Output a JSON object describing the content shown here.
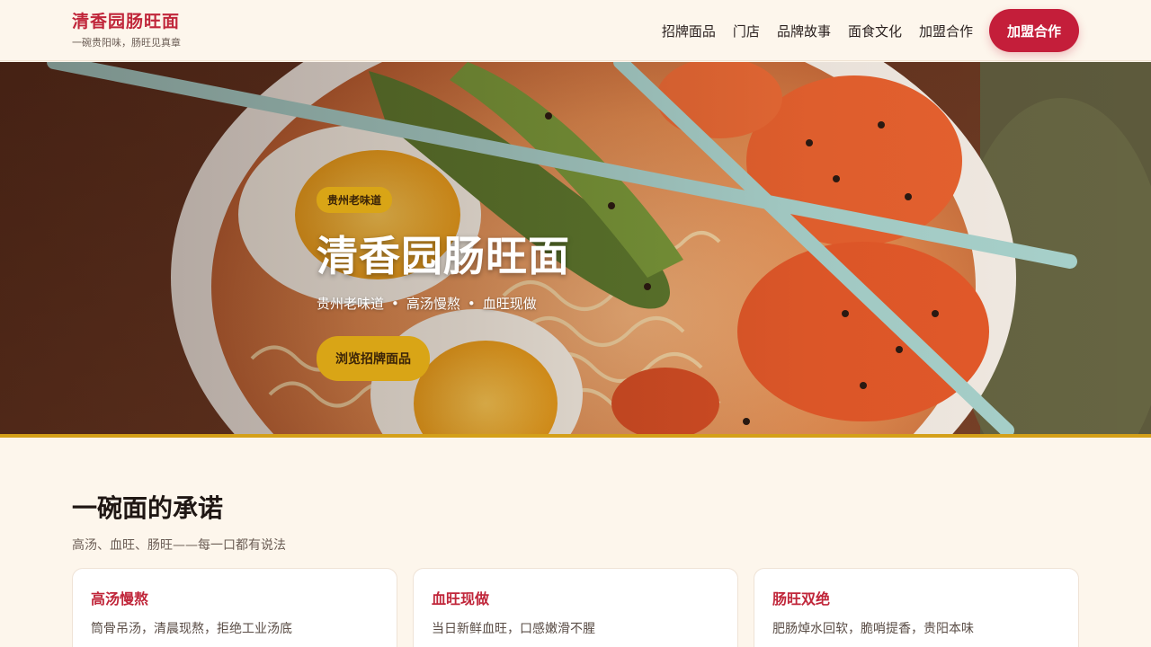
{
  "brand": {
    "name": "清香园肠旺面",
    "tagline": "一碗贵阳味，肠旺见真章"
  },
  "nav": {
    "items": [
      {
        "label": "招牌面品"
      },
      {
        "label": "门店"
      },
      {
        "label": "品牌故事"
      },
      {
        "label": "面食文化"
      },
      {
        "label": "加盟合作"
      }
    ],
    "cta": "加盟合作"
  },
  "hero": {
    "badge": "贵州老味道",
    "title": "清香园肠旺面",
    "subtitle": [
      "贵州老味道",
      "高汤慢熬",
      "血旺现做"
    ],
    "separator": "•",
    "button": "浏览招牌面品"
  },
  "promise": {
    "title": "一碗面的承诺",
    "subtitle": "高汤、血旺、肠旺——每一口都有说法",
    "cards": [
      {
        "title": "高汤慢熬",
        "text": "筒骨吊汤，清晨现熬，拒绝工业汤底"
      },
      {
        "title": "血旺现做",
        "text": "当日新鲜血旺，口感嫩滑不腥"
      },
      {
        "title": "肠旺双绝",
        "text": "肥肠焯水回软，脆哨提香，贵阳本味"
      }
    ]
  },
  "colors": {
    "brand_red": "#c41e3a",
    "gold": "#d9a516",
    "background": "#fdf6ec"
  }
}
